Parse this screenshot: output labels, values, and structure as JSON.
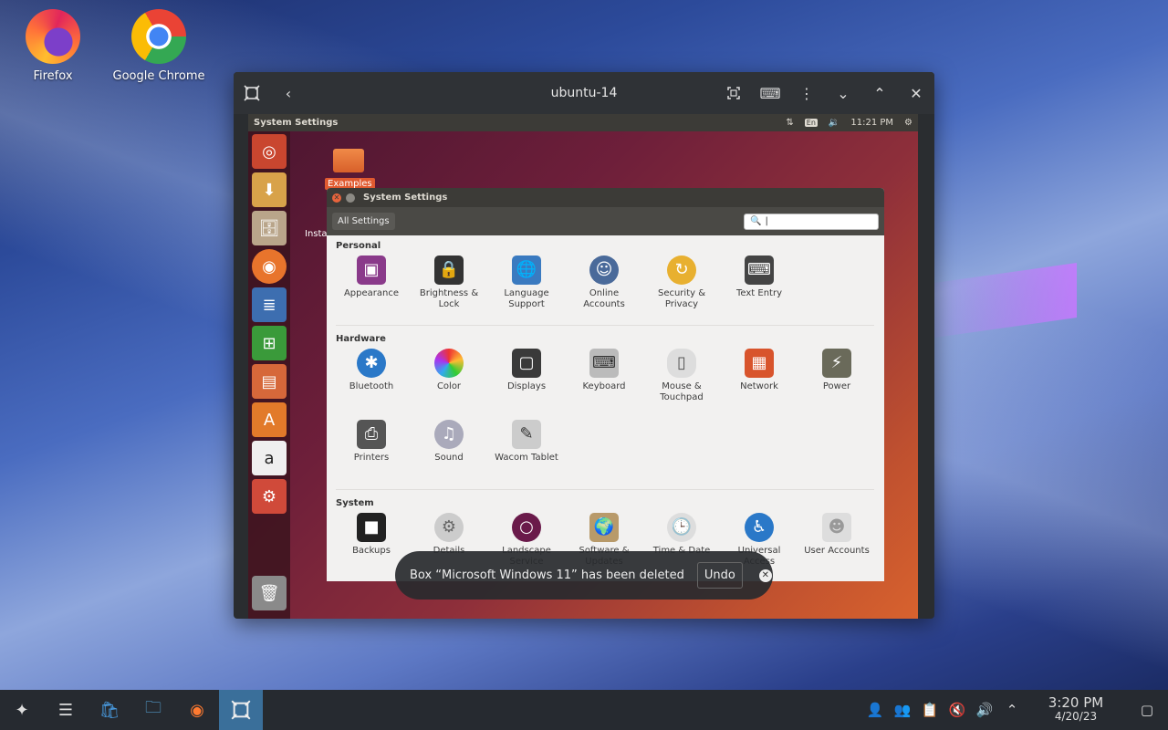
{
  "desktop": {
    "icons": [
      {
        "label": "Firefox"
      },
      {
        "label": "Google Chrome"
      }
    ]
  },
  "window": {
    "title": "ubuntu-14"
  },
  "guest": {
    "topbar_title": "System Settings",
    "topbar_lang": "En",
    "topbar_time": "11:21 PM",
    "examples_label": "Examples",
    "install_label": "Insta",
    "dialog": {
      "title": "System Settings",
      "all_settings": "All Settings",
      "search_value": "|",
      "sections": {
        "personal": "Personal",
        "hardware": "Hardware",
        "system": "System"
      },
      "personal": [
        "Appearance",
        "Brightness &\nLock",
        "Language\nSupport",
        "Online\nAccounts",
        "Security &\nPrivacy",
        "Text Entry"
      ],
      "hardware": [
        "Bluetooth",
        "Color",
        "Displays",
        "Keyboard",
        "Mouse &\nTouchpad",
        "Network",
        "Power",
        "Printers",
        "Sound",
        "Wacom Tablet"
      ],
      "system": [
        "Backups",
        "Details",
        "Landscape\nService",
        "Software &\nUpdates",
        "Time & Date",
        "Universal\nAccess",
        "User Accounts"
      ]
    }
  },
  "toast": {
    "message": "Box “Microsoft Windows 11” has been deleted",
    "undo": "Undo"
  },
  "taskbar": {
    "time": "3:20 PM",
    "date": "4/20/23"
  }
}
